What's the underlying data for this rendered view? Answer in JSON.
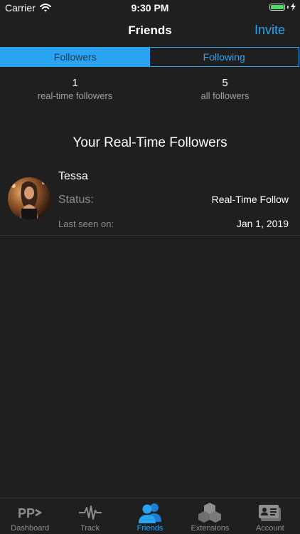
{
  "status_bar": {
    "carrier": "Carrier",
    "time": "9:30 PM"
  },
  "nav": {
    "title": "Friends",
    "invite_label": "Invite"
  },
  "segments": [
    {
      "label": "Followers",
      "active": true
    },
    {
      "label": "Following",
      "active": false
    }
  ],
  "stats": [
    {
      "value": "1",
      "label": "real-time followers"
    },
    {
      "value": "5",
      "label": "all followers"
    }
  ],
  "section_title": "Your Real-Time Followers",
  "followers": [
    {
      "name": "Tessa",
      "status_label": "Status:",
      "status_value": "Real-Time Follow",
      "last_seen_label": "Last seen on:",
      "last_seen_value": "Jan 1, 2019"
    }
  ],
  "tabs": [
    {
      "label": "Dashboard",
      "icon": "pp-logo-icon",
      "active": false
    },
    {
      "label": "Track",
      "icon": "pulse-icon",
      "active": false
    },
    {
      "label": "Friends",
      "icon": "people-icon",
      "active": true
    },
    {
      "label": "Extensions",
      "icon": "cubes-icon",
      "active": false
    },
    {
      "label": "Account",
      "icon": "id-card-icon",
      "active": false
    }
  ],
  "colors": {
    "accent": "#2aa3f0",
    "background": "#1f1f1f",
    "battery": "#4cd964"
  }
}
